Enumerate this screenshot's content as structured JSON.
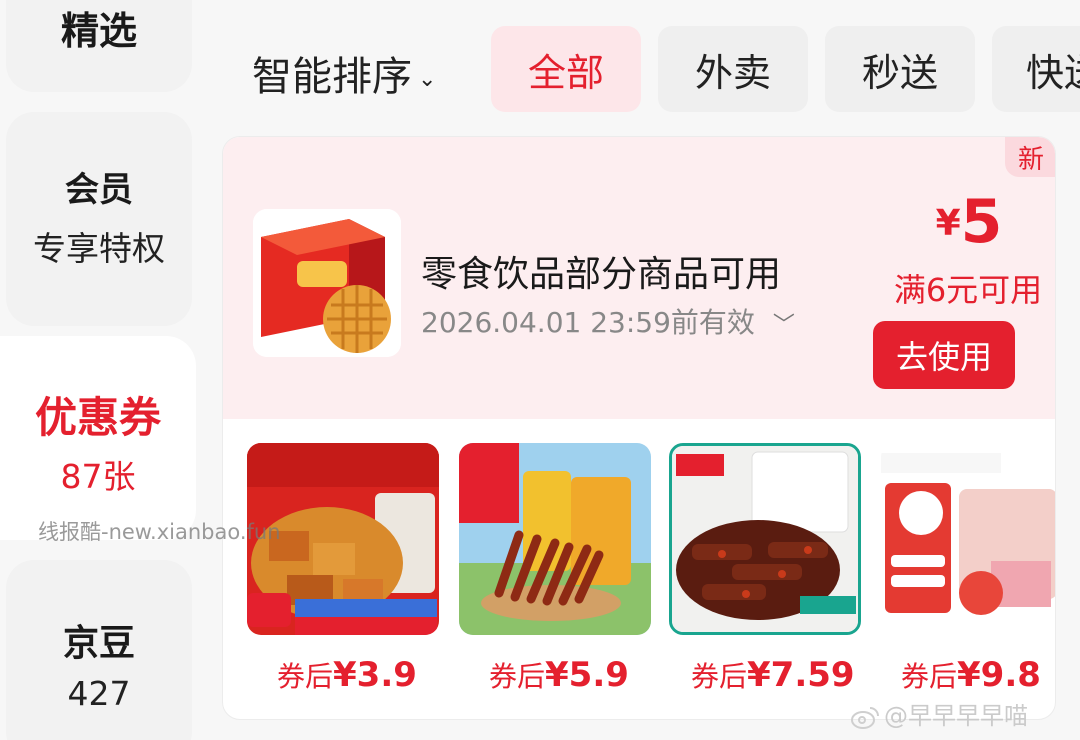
{
  "sidebar": {
    "items": [
      {
        "title": "精选"
      },
      {
        "title": "会员",
        "sub": "专享特权"
      },
      {
        "title": "优惠券",
        "sub": "87张"
      },
      {
        "title": "京豆",
        "sub": "427"
      }
    ]
  },
  "filter": {
    "sort_label": "智能排序",
    "tabs": [
      "全部",
      "外卖",
      "秒送",
      "快送"
    ]
  },
  "coupon": {
    "badge": "新",
    "title": "零食饮品部分商品可用",
    "expiry": "2026.04.01 23:59前有效",
    "currency": "¥",
    "amount": "5",
    "condition": "满6元可用",
    "use_label": "去使用"
  },
  "products": [
    {
      "prefix": "券后",
      "price": "¥3.9"
    },
    {
      "prefix": "券后",
      "price": "¥5.9"
    },
    {
      "prefix": "券后",
      "price": "¥7.59"
    },
    {
      "prefix": "券后",
      "price": "¥9.8"
    }
  ],
  "watermarks": {
    "site": "线报酷-new.xianbao.fun",
    "weibo": "@早早早早喵"
  },
  "colors": {
    "accent": "#e4202e",
    "coupon_bg": "#fdeef0"
  }
}
